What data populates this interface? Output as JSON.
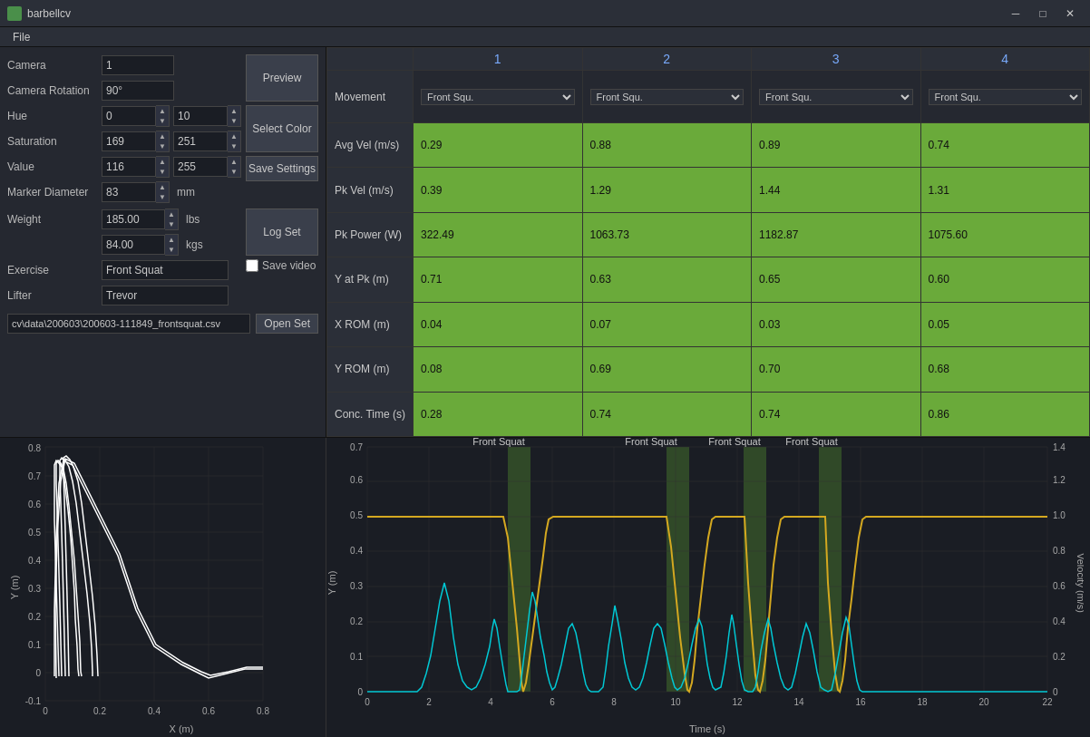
{
  "titlebar": {
    "icon": "barbell",
    "title": "barbellcv",
    "minimize": "─",
    "maximize": "□",
    "close": "✕"
  },
  "menubar": {
    "items": [
      "File"
    ]
  },
  "left_panel": {
    "camera_label": "Camera",
    "camera_value": "1",
    "camera_rotation_label": "Camera Rotation",
    "camera_rotation_value": "90°",
    "hue_label": "Hue",
    "hue_min": "0",
    "hue_max": "10",
    "saturation_label": "Saturation",
    "saturation_min": "169",
    "saturation_max": "251",
    "value_label": "Value",
    "value_min": "116",
    "value_max": "255",
    "marker_diameter_label": "Marker Diameter",
    "marker_diameter_value": "83",
    "marker_diameter_unit": "mm",
    "weight_label": "Weight",
    "weight_lbs_value": "185.00",
    "weight_lbs_unit": "lbs",
    "weight_kgs_value": "84.00",
    "weight_kgs_unit": "kgs",
    "exercise_label": "Exercise",
    "exercise_value": "Front Squat",
    "lifter_label": "Lifter",
    "lifter_value": "Trevor",
    "preview_btn": "Preview",
    "select_color_btn": "Select Color",
    "save_settings_btn": "Save Settings",
    "log_set_btn": "Log Set",
    "save_video_label": "Save video",
    "filepath": "cv\\data\\200603\\200603-111849_frontsquat.csv",
    "open_set_btn": "Open Set"
  },
  "table": {
    "columns": [
      {
        "num": "1",
        "color": "#7aacff"
      },
      {
        "num": "2",
        "color": "#7aacff"
      },
      {
        "num": "3",
        "color": "#7aacff"
      },
      {
        "num": "4",
        "color": "#7aacff"
      }
    ],
    "rows": [
      {
        "label": "Movement",
        "cells": [
          "Front Squ.",
          "Front Squ.",
          "Front Squ.",
          "Front Squ."
        ]
      },
      {
        "label": "Avg Vel (m/s)",
        "cells": [
          "0.29",
          "0.88",
          "0.89",
          "0.74"
        ],
        "green": true
      },
      {
        "label": "Pk Vel (m/s)",
        "cells": [
          "0.39",
          "1.29",
          "1.44",
          "1.31"
        ],
        "green": true
      },
      {
        "label": "Pk Power (W)",
        "cells": [
          "322.49",
          "1063.73",
          "1182.87",
          "1075.60"
        ],
        "green": true
      },
      {
        "label": "Y at Pk (m)",
        "cells": [
          "0.71",
          "0.63",
          "0.65",
          "0.60"
        ],
        "green": true
      },
      {
        "label": "X ROM (m)",
        "cells": [
          "0.04",
          "0.07",
          "0.03",
          "0.05"
        ],
        "green": true
      },
      {
        "label": "Y ROM (m)",
        "cells": [
          "0.08",
          "0.69",
          "0.70",
          "0.68"
        ],
        "green": true
      },
      {
        "label": "Conc. Time (s)",
        "cells": [
          "0.28",
          "0.74",
          "0.74",
          "0.86"
        ],
        "green": true
      }
    ]
  },
  "left_chart": {
    "x_label": "X (m)",
    "y_label": "Y (m)",
    "x_ticks": [
      "0",
      "0.2",
      "0.4",
      "0.6",
      "0.8"
    ],
    "y_ticks": [
      "-0.1",
      "0",
      "0.1",
      "0.2",
      "0.3",
      "0.4",
      "0.5",
      "0.6",
      "0.7",
      "0.8"
    ]
  },
  "right_chart": {
    "x_label": "Time (s)",
    "y_left_label": "Y (m)",
    "y_right_label": "Velocity (m/s)",
    "x_ticks": [
      "0",
      "2",
      "4",
      "6",
      "8",
      "10",
      "12",
      "14",
      "16",
      "18",
      "20",
      "22"
    ],
    "y_left_ticks": [
      "0",
      "0.1",
      "0.2",
      "0.3",
      "0.4",
      "0.5",
      "0.6",
      "0.7"
    ],
    "y_right_ticks": [
      "0",
      "0.2",
      "0.4",
      "0.6",
      "0.8",
      "1.0",
      "1.2",
      "1.4"
    ],
    "labels": [
      {
        "x": 590,
        "text": "Front Squat"
      },
      {
        "x": 740,
        "text": "Front Squat"
      },
      {
        "x": 860,
        "text": "Front Squat"
      },
      {
        "x": 960,
        "text": "Front Squat"
      }
    ]
  }
}
